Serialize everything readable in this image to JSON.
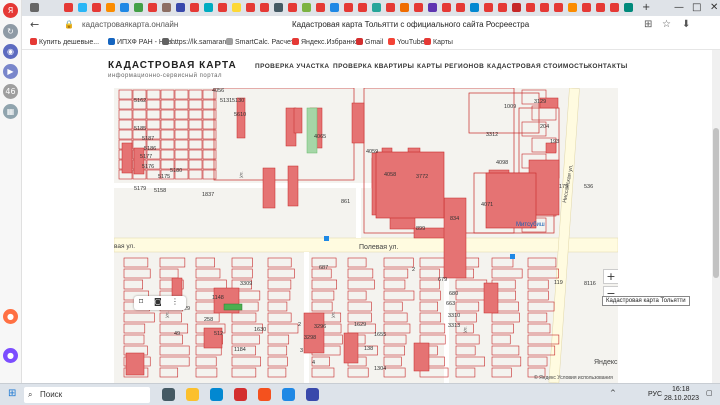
{
  "browser": {
    "url": "кадастроваякарта.онлайн",
    "page_title": "Кадастровая карта Тольятти с официального сайта Росреестра",
    "bookmarks": [
      "Купить дешевые...",
      "ИПХФ РАН - Нов...",
      "https://lk.samaran...",
      "SmartCalc. Расчет...",
      "Яндекс.Избранное",
      "Gmail",
      "YouTube",
      "Карты"
    ]
  },
  "site": {
    "logo": "КАДАСТРОВАЯ КАРТА",
    "tagline": "информационно-сервисный портал",
    "menu": [
      "ПРОВЕРКА УЧАСТКА",
      "ПРОВЕРКА КВАРТИРЫ",
      "КАРТЫ РЕГИОНОВ",
      "КАДАСТРОВАЯ СТОИМОСТЬ",
      "КОНТАКТЫ"
    ]
  },
  "map": {
    "street_polevaya": "Полевая ул.",
    "street_left": "вая ул.",
    "street_rightside": "Ниссанская ул.",
    "label_mitsubishi": "Митсубиш",
    "zoom_in": "+",
    "zoom_out": "−",
    "tooltip": "Кадастровая карта Тольятти",
    "attribution": "Яндекс",
    "copyright": "© Яндекс  Условия использования",
    "building_numbers": [
      "4056",
      "5131",
      "5130",
      "5162",
      "5185",
      "5187",
      "5186",
      "5177",
      "5176",
      "5175",
      "5180",
      "5179",
      "5158",
      "1837",
      "5610",
      "4065",
      "4059",
      "4058",
      "3772",
      "3312",
      "1009",
      "3129",
      "204",
      "193",
      "175",
      "4098",
      "899",
      "834",
      "4071",
      "861",
      "687",
      "2",
      "679",
      "680",
      "663",
      "3310",
      "3313",
      "3309",
      "1148",
      "258",
      "512",
      "1630",
      "1184",
      "3298",
      "1304",
      "1629",
      "4",
      "138",
      "1655",
      "29",
      "49",
      "3296",
      "119",
      "8116",
      "536",
      "2",
      "3"
    ],
    "street_short_labels": [
      "ул.",
      "ул.",
      "ул.",
      "ул."
    ]
  },
  "taskbar": {
    "search": "Поиск",
    "lang": "РУС",
    "time": "16:18",
    "date": "28.10.2023"
  },
  "colors": {
    "parcel_fill": "#e57373",
    "parcel_stroke": "#c62828",
    "road": "#fffbe0",
    "accent_green": "#4caf50"
  }
}
